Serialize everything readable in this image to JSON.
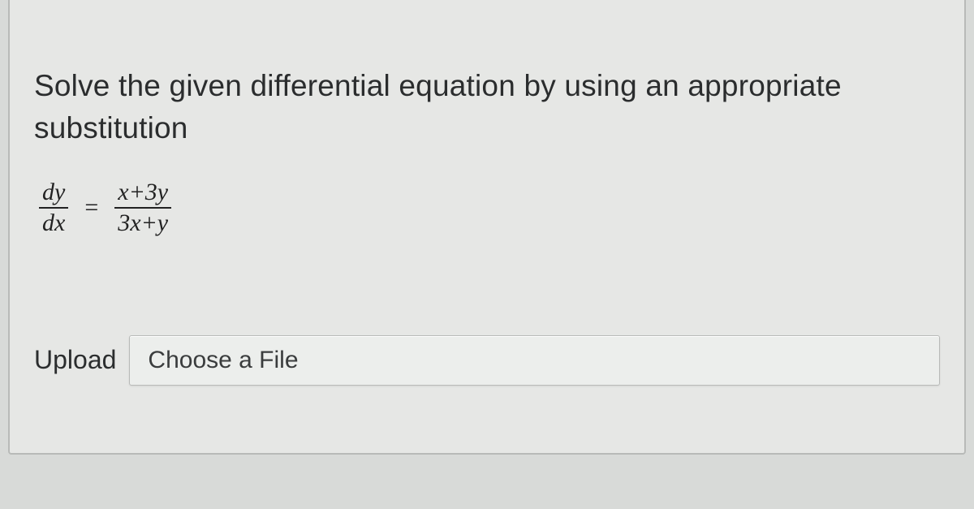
{
  "question": {
    "prompt": "Solve the given differential equation by using an appropriate substitution",
    "equation": {
      "lhs_num": "dy",
      "lhs_den": "dx",
      "eq": "=",
      "rhs_num": "x+3y",
      "rhs_den": "3x+y"
    }
  },
  "upload": {
    "label": "Upload",
    "placeholder": "Choose a File"
  }
}
